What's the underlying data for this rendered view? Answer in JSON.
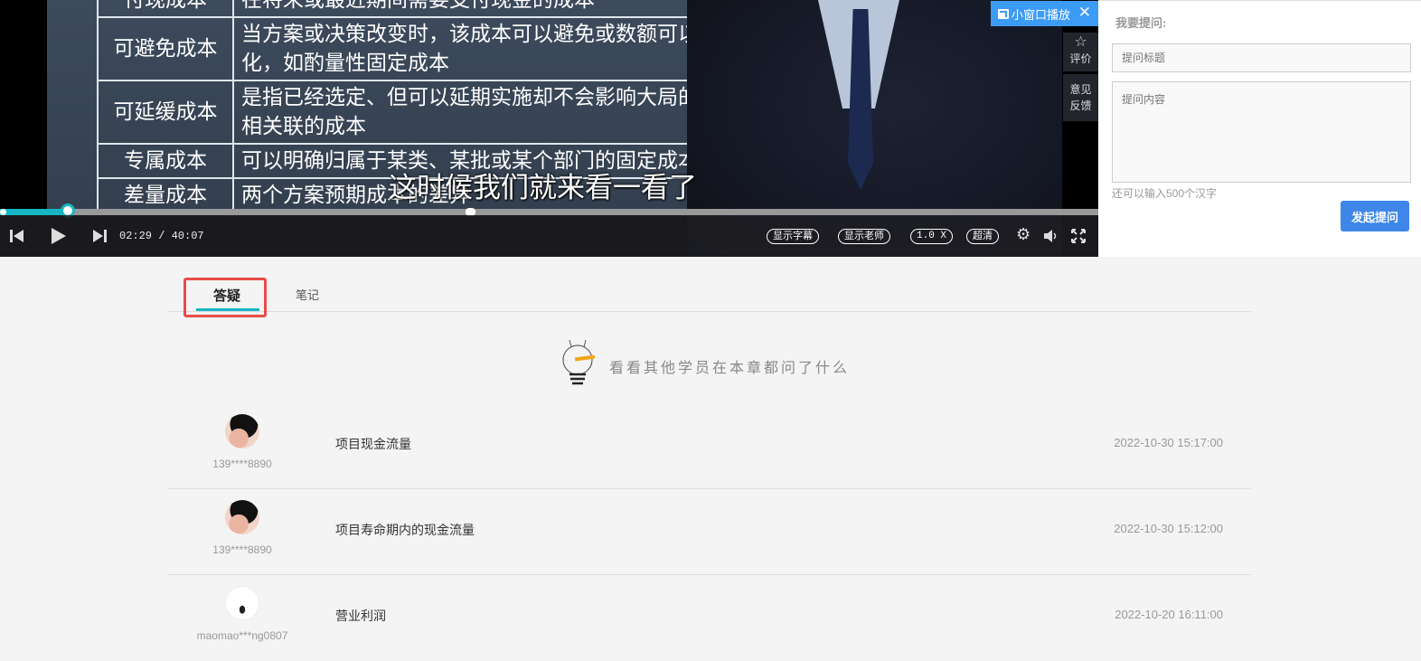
{
  "video": {
    "slide_rows": [
      {
        "term": "付现成本",
        "desc": "在将来或最近期间需要支付现金的成本"
      },
      {
        "term": "可避免成本",
        "desc": "当方案或决策改变时，该成本可以避免或数额可以发生变化，如酌量性固定成本"
      },
      {
        "term": "可延缓成本",
        "desc": "是指已经选定、但可以延期实施却不会影响大局的与方案相关联的成本"
      },
      {
        "term": "专属成本",
        "desc": "可以明确归属于某类、某批或某个部门的固定成本"
      },
      {
        "term": "差量成本",
        "desc": "两个方案预期成本的差异"
      }
    ],
    "subtitle": "这时候我们就来看一看了",
    "mini_window_label": "小窗口播放",
    "rate_label": "评价",
    "feedback_label_1": "意见",
    "feedback_label_2": "反馈",
    "current_time": "02:29",
    "duration": "40:07",
    "time_display": "02:29 / 40:07",
    "progress_fraction": 0.062,
    "show_subtitles": "显示字幕",
    "show_teacher": "显示老师",
    "speed": "1.0 X",
    "quality": "超清"
  },
  "ask_panel": {
    "title": "我要提问:",
    "title_placeholder": "提问标题",
    "content_placeholder": "提问内容",
    "remaining": "还可以输入500个汉字",
    "submit": "发起提问"
  },
  "tabs": [
    {
      "label": "答疑",
      "active": true
    },
    {
      "label": "笔记",
      "active": false
    }
  ],
  "hint": "看看其他学员在本章都问了什么",
  "questions": [
    {
      "user": "139****8890",
      "title": "项目现金流量",
      "date": "2022-10-30 15:17:00"
    },
    {
      "user": "139****8890",
      "title": "项目寿命期内的现金流量",
      "date": "2022-10-30 15:12:00"
    },
    {
      "user": "maomao***ng0807",
      "title": "营业利润",
      "date": "2022-10-20 16:11:00"
    }
  ],
  "colors": {
    "accent": "#17b6c3",
    "button": "#3e87e8",
    "highlight": "#ea4b4b"
  }
}
